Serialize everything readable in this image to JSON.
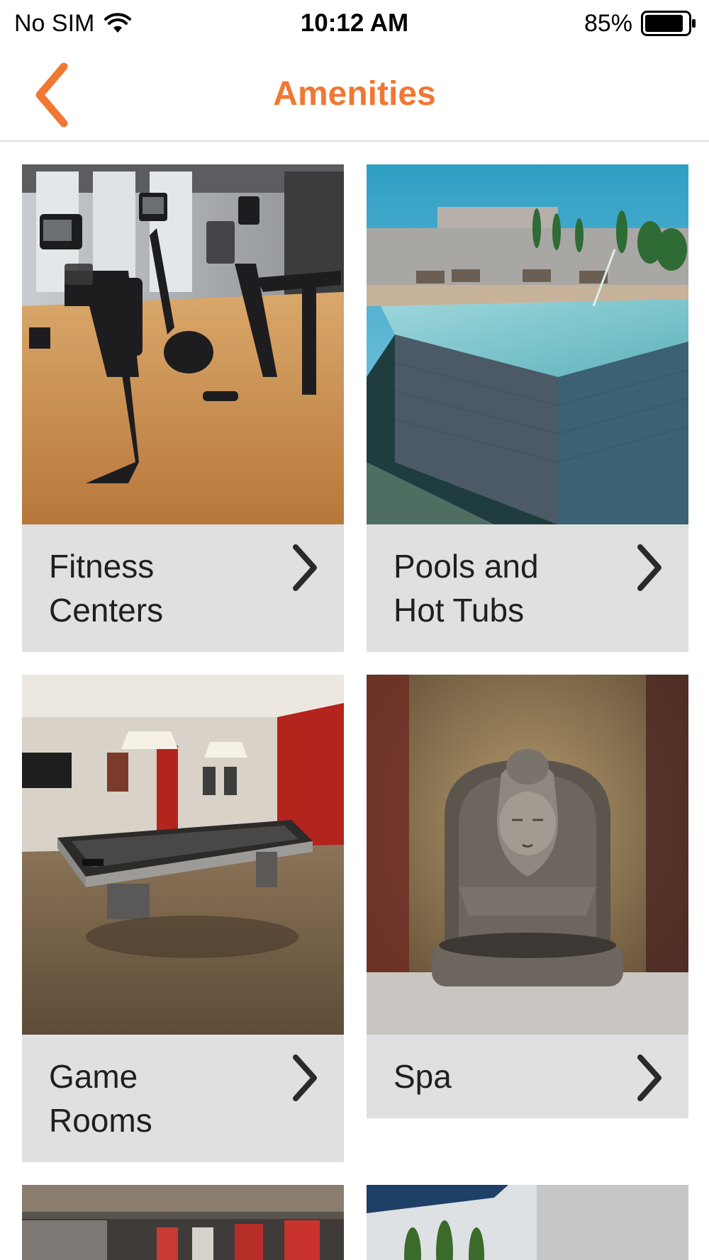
{
  "status_bar": {
    "carrier": "No SIM",
    "time": "10:12 AM",
    "battery_level": "85%",
    "icons": [
      "wifi-icon",
      "battery-icon"
    ]
  },
  "nav": {
    "title": "Amenities",
    "back_icon": "chevron-left-icon",
    "accent_color": "#f07832"
  },
  "amenities": [
    {
      "label": "Fitness Centers",
      "image": "gym-photo"
    },
    {
      "label": "Pools and Hot Tubs",
      "image": "pool-photo"
    },
    {
      "label": "Game Rooms",
      "image": "billiards-room-photo"
    },
    {
      "label": "Spa",
      "image": "buddha-fountain-photo"
    },
    {
      "label": "",
      "image": "lounge-photo"
    },
    {
      "label": "",
      "image": "courtyard-photo"
    }
  ],
  "colors": {
    "label_background": "#e0e0e0",
    "label_text": "#1f1f1f",
    "chevron": "#2a2a2a"
  }
}
